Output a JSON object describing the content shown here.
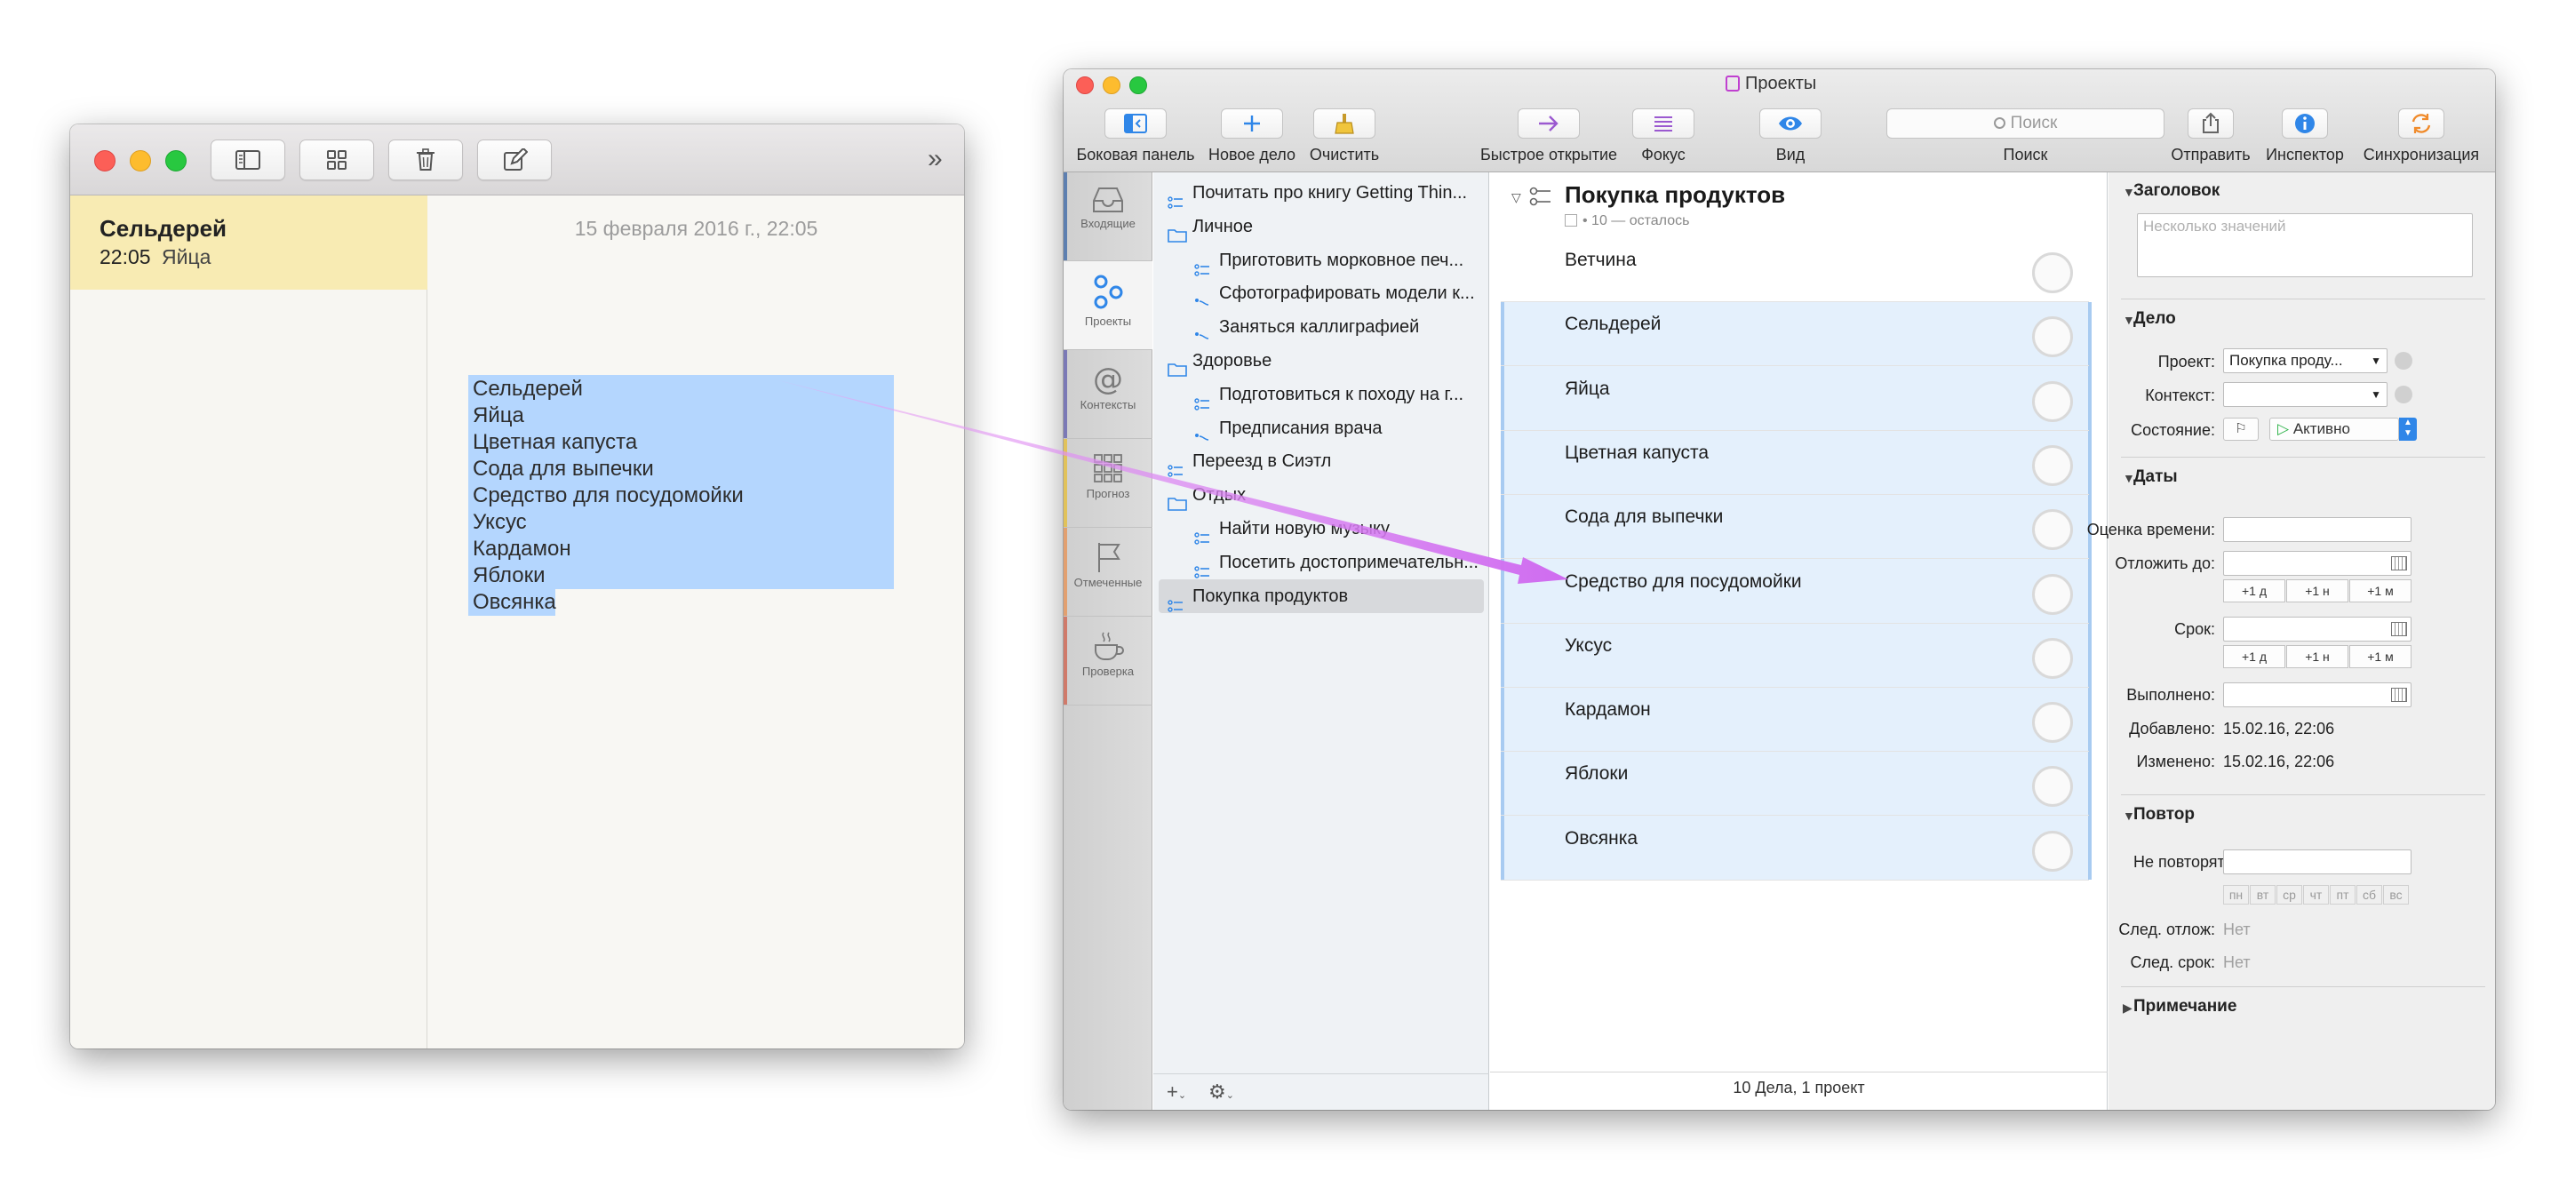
{
  "notes": {
    "list_title": "Сельдерей",
    "list_time": "22:05",
    "list_preview": "Яйца",
    "date": "15 февраля 2016 г., 22:05",
    "lines": [
      "Сельдерей",
      "Яйца",
      "Цветная капуста",
      "Сода для выпечки",
      "Средство для посудомойки",
      "Уксус",
      "Кардамон",
      "Яблоки",
      "Овсянка"
    ],
    "toolbar_icons": [
      "sidebar-toggle-icon",
      "grid-icon",
      "trash-icon",
      "compose-icon"
    ],
    "overflow_glyph": "»"
  },
  "omnifocus": {
    "window_title": "Проекты",
    "toolbar": {
      "sidebar": "Боковая панель",
      "new_task": "Новое дело",
      "clean": "Очистить",
      "quick_open": "Быстрое открытие",
      "focus": "Фокус",
      "view": "Вид",
      "search_placeholder": "Поиск",
      "search_label": "Поиск",
      "share": "Отправить",
      "inspector": "Инспектор",
      "sync": "Синхронизация"
    },
    "perspectives": [
      "Входящие",
      "Проекты",
      "Контексты",
      "Прогноз",
      "Отмеченные",
      "Проверка"
    ],
    "outline": [
      {
        "label": "Почитать про книгу Getting Thin...",
        "icon": "project-icon"
      },
      {
        "label": "Личное",
        "icon": "folder-icon"
      },
      {
        "label": "Приготовить морковное печ...",
        "icon": "project-icon"
      },
      {
        "label": "Сфотографировать модели к...",
        "icon": "single-actions-icon"
      },
      {
        "label": "Заняться каллиграфией",
        "icon": "single-actions-icon"
      },
      {
        "label": "Здоровье",
        "icon": "folder-icon"
      },
      {
        "label": "Подготовиться к походу на г...",
        "icon": "project-icon"
      },
      {
        "label": "Предписания врача",
        "icon": "single-actions-icon"
      },
      {
        "label": "Переезд в Сиэтл",
        "icon": "project-icon"
      },
      {
        "label": "Отдых",
        "icon": "folder-icon"
      },
      {
        "label": "Найти новую музыку",
        "icon": "project-icon"
      },
      {
        "label": "Посетить достопримечательн...",
        "icon": "project-icon"
      },
      {
        "label": "Покупка продуктов",
        "icon": "project-icon"
      }
    ],
    "project": {
      "title": "Покупка продуктов",
      "subtitle": "• 10 — осталось",
      "tasks": [
        "Ветчина",
        "Сельдерей",
        "Яйца",
        "Цветная капуста",
        "Сода для выпечки",
        "Средство для посудомойки",
        "Уксус",
        "Кардамон",
        "Яблоки",
        "Овсянка"
      ]
    },
    "status_bar": "10 Дела, 1 проект",
    "inspector": {
      "title_section": "Заголовок",
      "title_placeholder": "Несколько значений",
      "task_section": "Дело",
      "project_label": "Проект:",
      "project_value": "Покупка проду...",
      "context_label": "Контекст:",
      "context_value": "",
      "state_label": "Состояние:",
      "state_value": "Активно",
      "dates_section": "Даты",
      "estimate_label": "Оценка времени:",
      "defer_label": "Отложить до:",
      "due_label": "Срок:",
      "completed_label": "Выполнено:",
      "added_label": "Добавлено:",
      "added_value": "15.02.16, 22:06",
      "modified_label": "Изменено:",
      "modified_value": "15.02.16, 22:06",
      "quick_buttons": [
        "+1 д",
        "+1 н",
        "+1 м"
      ],
      "repeat_section": "Повтор",
      "repeat_value": "Не повторять",
      "weekdays": [
        "пн",
        "вт",
        "ср",
        "чт",
        "пт",
        "сб",
        "вс"
      ],
      "next_defer_label": "След. отлож:",
      "next_defer_value": "Нет",
      "next_due_label": "След. срок:",
      "next_due_value": "Нет",
      "note_section": "Примечание"
    },
    "colors": {
      "selection": "#b4d6fe",
      "task_highlight": "#e4f0fc",
      "arrow": "#d77ef0",
      "accent": "#2f86e8"
    }
  }
}
